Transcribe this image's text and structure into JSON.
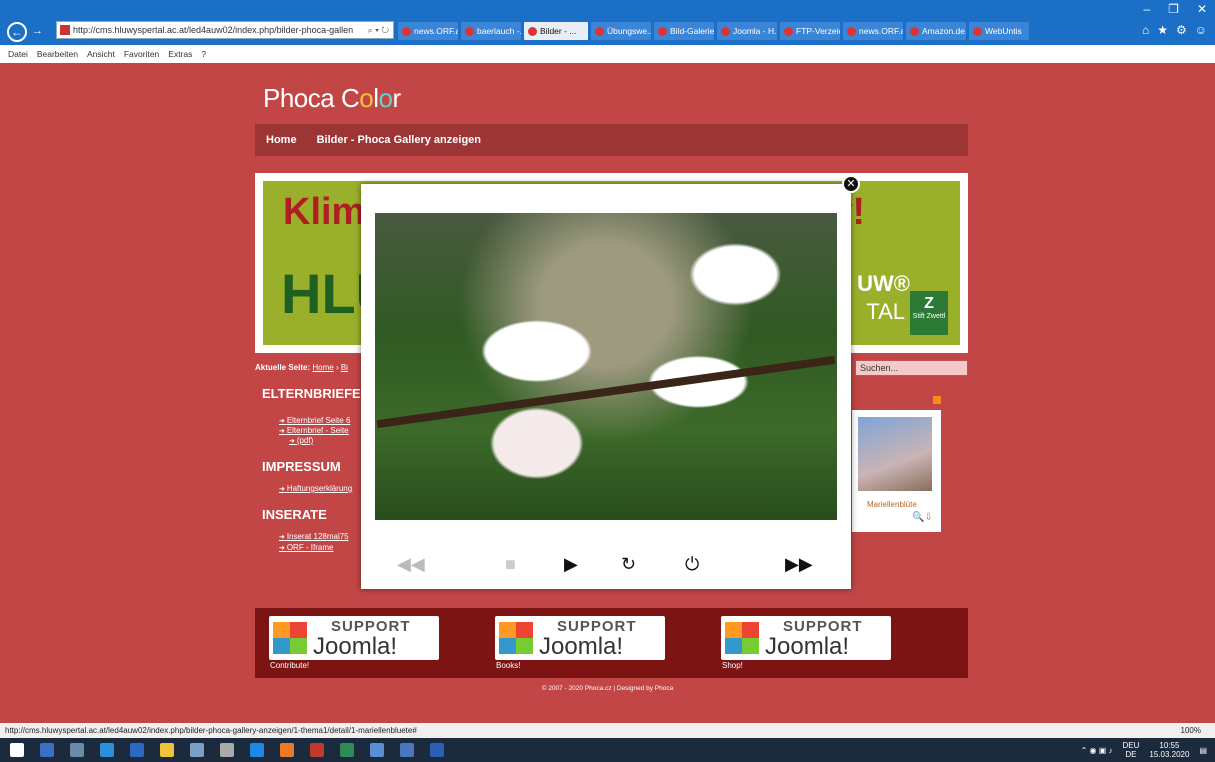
{
  "browser": {
    "address": "http://cms.hluwyspertal.ac.at/led4auw02/index.php/bilder-phoca-gallen",
    "tabs": [
      "news.ORF.at",
      "baerlauch -...",
      "Bilder - ...",
      "Übungswe...",
      "Bild-Galerie...",
      "Joomla - H...",
      "FTP-Verzeic...",
      "news.ORF.at",
      "Amazon.de...",
      "WebUntis"
    ],
    "menu": [
      "Datei",
      "Bearbeiten",
      "Ansicht",
      "Favoriten",
      "Extras",
      "?"
    ]
  },
  "site": {
    "title_pre": "Phoca C",
    "title_o1": "o",
    "title_l": "l",
    "title_o2": "o",
    "title_r": "r",
    "nav": [
      "Home",
      "Bilder - Phoca Gallery anzeigen"
    ],
    "banner": {
      "klim": "Klim",
      "excl": "y!",
      "hlu": "HLU",
      "uw": "UW®",
      "tal": "TAL",
      "z": "Z",
      "zlabel": "Stift Zwettl"
    },
    "breadcrumb_label": "Aktuelle Seite:",
    "breadcrumb_home": "Home",
    "breadcrumb_next": "Bi",
    "search_placeholder": "Suchen...",
    "sections": [
      {
        "title": "ELTERNBRIEFE",
        "links": [
          "Elternbrief Seite 6",
          "Elternbrief - Seite",
          "(pdf)"
        ]
      },
      {
        "title": "IMPRESSUM",
        "links": [
          "Haftungserklärung"
        ]
      },
      {
        "title": "INSERATE",
        "links": [
          "Inserat 128mal75",
          "ORF - Iframe"
        ]
      }
    ],
    "thumb_label": "Mariellenblüte",
    "support": [
      {
        "t1": "SUPPORT",
        "t2": "Joomla!",
        "label": "Contribute!"
      },
      {
        "t1": "SUPPORT",
        "t2": "Joomla!",
        "label": "Books!"
      },
      {
        "t1": "SUPPORT",
        "t2": "Joomla!",
        "label": "Shop!"
      }
    ],
    "footer": "© 2007 - 2020 Phoca.cz | Designed by Phoca"
  },
  "slideshow": {
    "controls": {
      "prev": "◀◀",
      "stop": "■",
      "play": "▶",
      "reload": "↻",
      "power": "⏻",
      "next": "▶▶"
    },
    "close": "✕"
  },
  "status": {
    "url": "http://cms.hluwyspertal.ac.at/led4auw02/index.php/bilder-phoca-gallery-anzeigen/1-thema1/detail/1-mariellenbluete#",
    "zoom": "100%"
  },
  "taskbar": {
    "lang": "DEU",
    "lang2": "DE",
    "time": "10:55",
    "date": "15.03.2020"
  }
}
